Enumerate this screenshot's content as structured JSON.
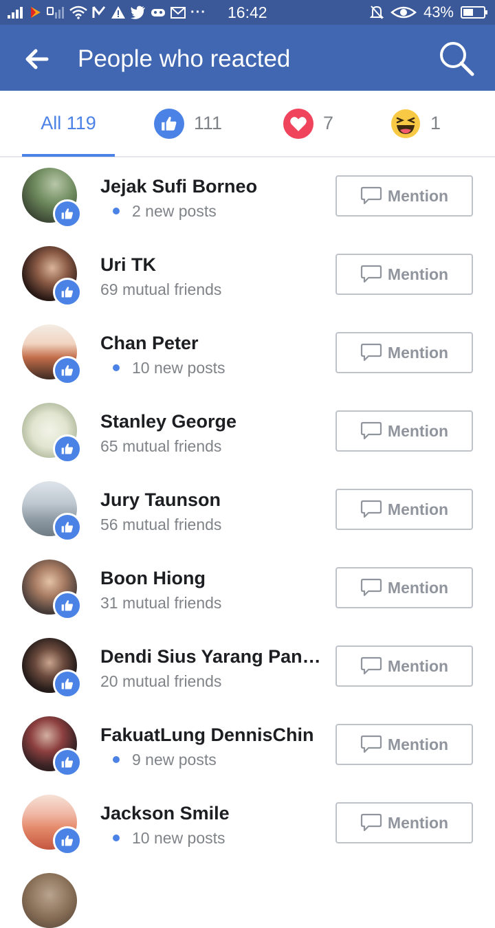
{
  "status_bar": {
    "time": "16:42",
    "battery": "43%",
    "more": "···"
  },
  "app_bar": {
    "title": "People who reacted"
  },
  "tabs": {
    "all_label": "All 119",
    "like_count": "111",
    "love_count": "7",
    "haha_count": "1"
  },
  "colors": {
    "header": "#4267b2",
    "accent": "#4b82e6",
    "love": "#f0445c",
    "haha": "#f7c945"
  },
  "people": [
    {
      "name": "Jejak Sufi Borneo",
      "subtitle": "2 new posts",
      "has_dot": true,
      "reaction": "like"
    },
    {
      "name": "Uri TK",
      "subtitle": "69 mutual friends",
      "has_dot": false,
      "reaction": "like"
    },
    {
      "name": "Chan Peter",
      "subtitle": "10 new posts",
      "has_dot": true,
      "reaction": "like"
    },
    {
      "name": "Stanley George",
      "subtitle": "65 mutual friends",
      "has_dot": false,
      "reaction": "like"
    },
    {
      "name": "Jury Taunson",
      "subtitle": "56 mutual friends",
      "has_dot": false,
      "reaction": "like"
    },
    {
      "name": "Boon Hiong",
      "subtitle": "31 mutual friends",
      "has_dot": false,
      "reaction": "like"
    },
    {
      "name": "Dendi Sius Yarang Pang...",
      "subtitle": "20 mutual friends",
      "has_dot": false,
      "reaction": "like"
    },
    {
      "name": "FakuatLung DennisChin",
      "subtitle": "9 new posts",
      "has_dot": true,
      "reaction": "like"
    },
    {
      "name": "Jackson Smile",
      "subtitle": "10 new posts",
      "has_dot": true,
      "reaction": "like"
    }
  ],
  "mention_label": "Mention"
}
